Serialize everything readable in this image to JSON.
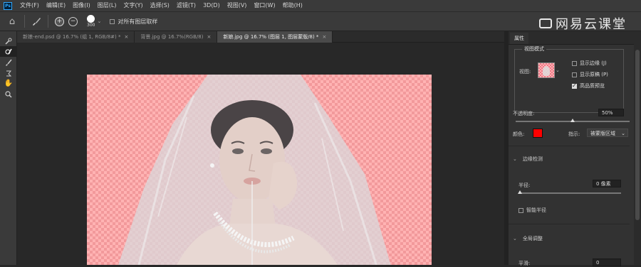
{
  "app": {
    "logo_text": "Ps"
  },
  "menubar": {
    "items": [
      "文件(F)",
      "编辑(E)",
      "图像(I)",
      "图层(L)",
      "文字(Y)",
      "选择(S)",
      "滤镜(T)",
      "3D(D)",
      "视图(V)",
      "窗口(W)",
      "帮助(H)"
    ]
  },
  "options": {
    "brush_size": "300",
    "sample_all_layers_label": "对所有图层取样",
    "sample_all_layers_checked": false
  },
  "watermark": {
    "text": "网易云课堂"
  },
  "tabs": [
    {
      "label": "新娘-end.psd @ 16.7% (组 1, RGB/8#) *",
      "active": false
    },
    {
      "label": "背景.jpg @ 16.7%(RGB/8)",
      "active": false
    },
    {
      "label": "新娘.jpg @ 16.7% (图层 1, 图层蒙版/8) *",
      "active": true
    }
  ],
  "toolbar": {
    "icons": [
      "quick-selection-icon",
      "refine-edge-brush-icon",
      "brush-icon",
      "lasso-icon",
      "hand-icon",
      "zoom-icon"
    ],
    "active_index": 1
  },
  "properties": {
    "tab_label": "属性",
    "view_mode": {
      "title": "视图模式",
      "view_label": "视图:",
      "show_edge": {
        "label": "显示边缘 (J)",
        "checked": false
      },
      "show_original": {
        "label": "显示原稿 (P)",
        "checked": false
      },
      "high_quality": {
        "label": "高品质预览",
        "checked": true
      }
    },
    "opacity": {
      "label": "不透明度:",
      "value": "50%",
      "fraction": 0.5
    },
    "color": {
      "label": "颜色:",
      "swatch": "#ff0000"
    },
    "indicate": {
      "label": "指示:",
      "value": "被蒙版区域"
    },
    "edge_detection": {
      "title": "边缘检测"
    },
    "radius": {
      "label": "半径:",
      "value": "0 像素",
      "fraction": 0.0
    },
    "smart_radius": {
      "label": "智能半径",
      "checked": false
    },
    "global_refine": {
      "title": "全局调整"
    },
    "smooth": {
      "label": "平滑:",
      "value": "0"
    }
  },
  "colors": {
    "checker_light": "#ffb3b3",
    "checker_dark": "#f2999b",
    "panel_bg": "#323232",
    "canvas_bg": "#282828"
  }
}
